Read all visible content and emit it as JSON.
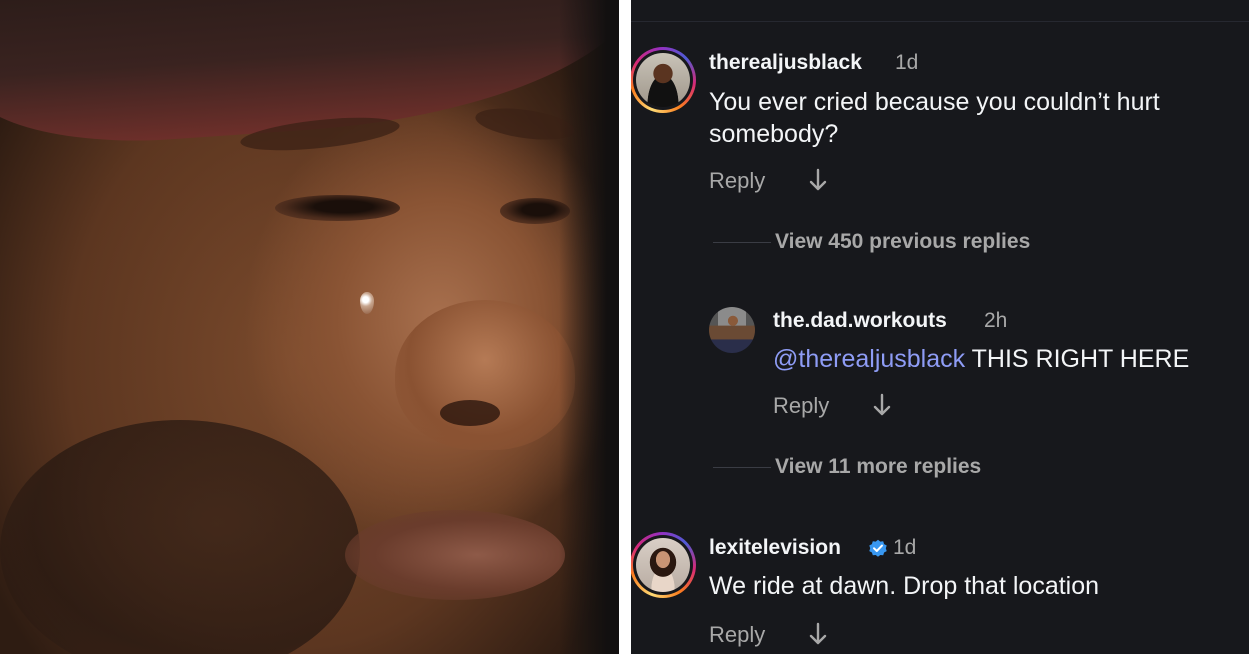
{
  "photo": {
    "description_icon": "crying-man-photo"
  },
  "comments": [
    {
      "username": "therealjusblack",
      "time": "1d",
      "text": "You ever cried because you couldn’t hurt somebody?",
      "reply_label": "Reply",
      "verified": false
    },
    {
      "view_replies": "View 450 previous replies"
    },
    {
      "username": "the.dad.workouts",
      "time": "2h",
      "mention": "@therealjusblack",
      "text": " THIS RIGHT HERE",
      "reply_label": "Reply"
    },
    {
      "view_replies": "View 11 more replies"
    },
    {
      "username": "lexitelevision",
      "time": "1d",
      "text": "We ride at dawn. Drop that location",
      "reply_label": "Reply",
      "verified": true
    }
  ],
  "colors": {
    "panel_bg": "#17181c",
    "muted": "#a8a8a8",
    "mention": "#8e9cf5",
    "verified": "#3897f0"
  }
}
